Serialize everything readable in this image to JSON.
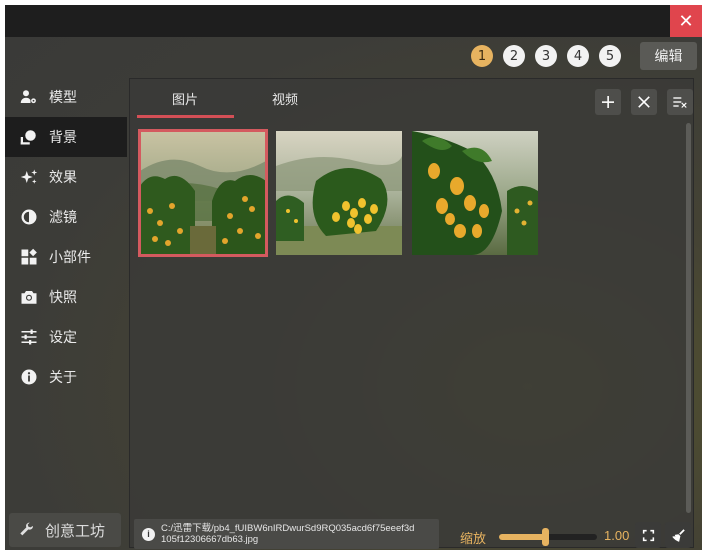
{
  "window": {
    "close_label": "✕"
  },
  "header": {
    "pages": [
      "1",
      "2",
      "3",
      "4",
      "5"
    ],
    "active_page": 0,
    "edit_label": "编辑"
  },
  "sidebar": {
    "items": [
      {
        "label": "模型",
        "icon": "model-icon"
      },
      {
        "label": "背景",
        "icon": "background-icon"
      },
      {
        "label": "效果",
        "icon": "sparkle-icon"
      },
      {
        "label": "滤镜",
        "icon": "filter-icon"
      },
      {
        "label": "小部件",
        "icon": "widget-icon"
      },
      {
        "label": "快照",
        "icon": "camera-icon"
      },
      {
        "label": "设定",
        "icon": "settings-sliders-icon"
      },
      {
        "label": "关于",
        "icon": "info-icon"
      }
    ],
    "active_index": 1,
    "tools_label": "创意工坊"
  },
  "panel": {
    "tabs": [
      {
        "label": "图片"
      },
      {
        "label": "视频"
      }
    ],
    "active_tab": 0,
    "toolbar": {
      "add_icon": "plus-icon",
      "remove_icon": "close-icon",
      "clear_icon": "clear-list-icon"
    },
    "thumbnails": [
      {
        "name": "mango-orchard-misty-valley",
        "selected": true
      },
      {
        "name": "mango-tree-cluster-close",
        "selected": false
      },
      {
        "name": "mango-fruit-foreground",
        "selected": false
      }
    ]
  },
  "status": {
    "path": "C:/迅雷下载/pb4_fUIBW6nIRDwurSd9RQ035acd6f75eeef3d105f12306667db63.jpg",
    "path_line1": "C:/迅雷下载/pb4_fUIBW6nIRDwurSd9RQ035acd6f75eeef3d",
    "path_line2": "105f12306667db63.jpg",
    "zoom_label": "缩放",
    "zoom_value": "1.00",
    "zoom_fraction": 0.47
  },
  "colors": {
    "accent": "#e7b360",
    "selection": "#d45a5f",
    "close": "#e0454d"
  }
}
